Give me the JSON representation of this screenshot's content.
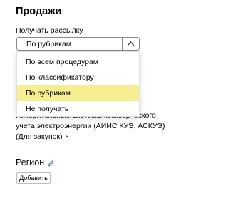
{
  "section_title": "Продажи",
  "mailing": {
    "label": "Получать рассылку",
    "selected_value": "По рубрикам",
    "options": [
      "По всем процедурам",
      "По классификатору",
      "По рубрикам",
      "Не получать"
    ],
    "selected_index": 2,
    "highlight_color": "#f6ef90"
  },
  "rubric_text": "измерительные системы коммерческого учета электроэнергии (АИИС КУЭ, АСКУЭ) (Для закупок)",
  "remove_symbol": "×",
  "region": {
    "label": "Регион",
    "edit_icon": "pencil-icon",
    "add_button": "Добавить"
  }
}
